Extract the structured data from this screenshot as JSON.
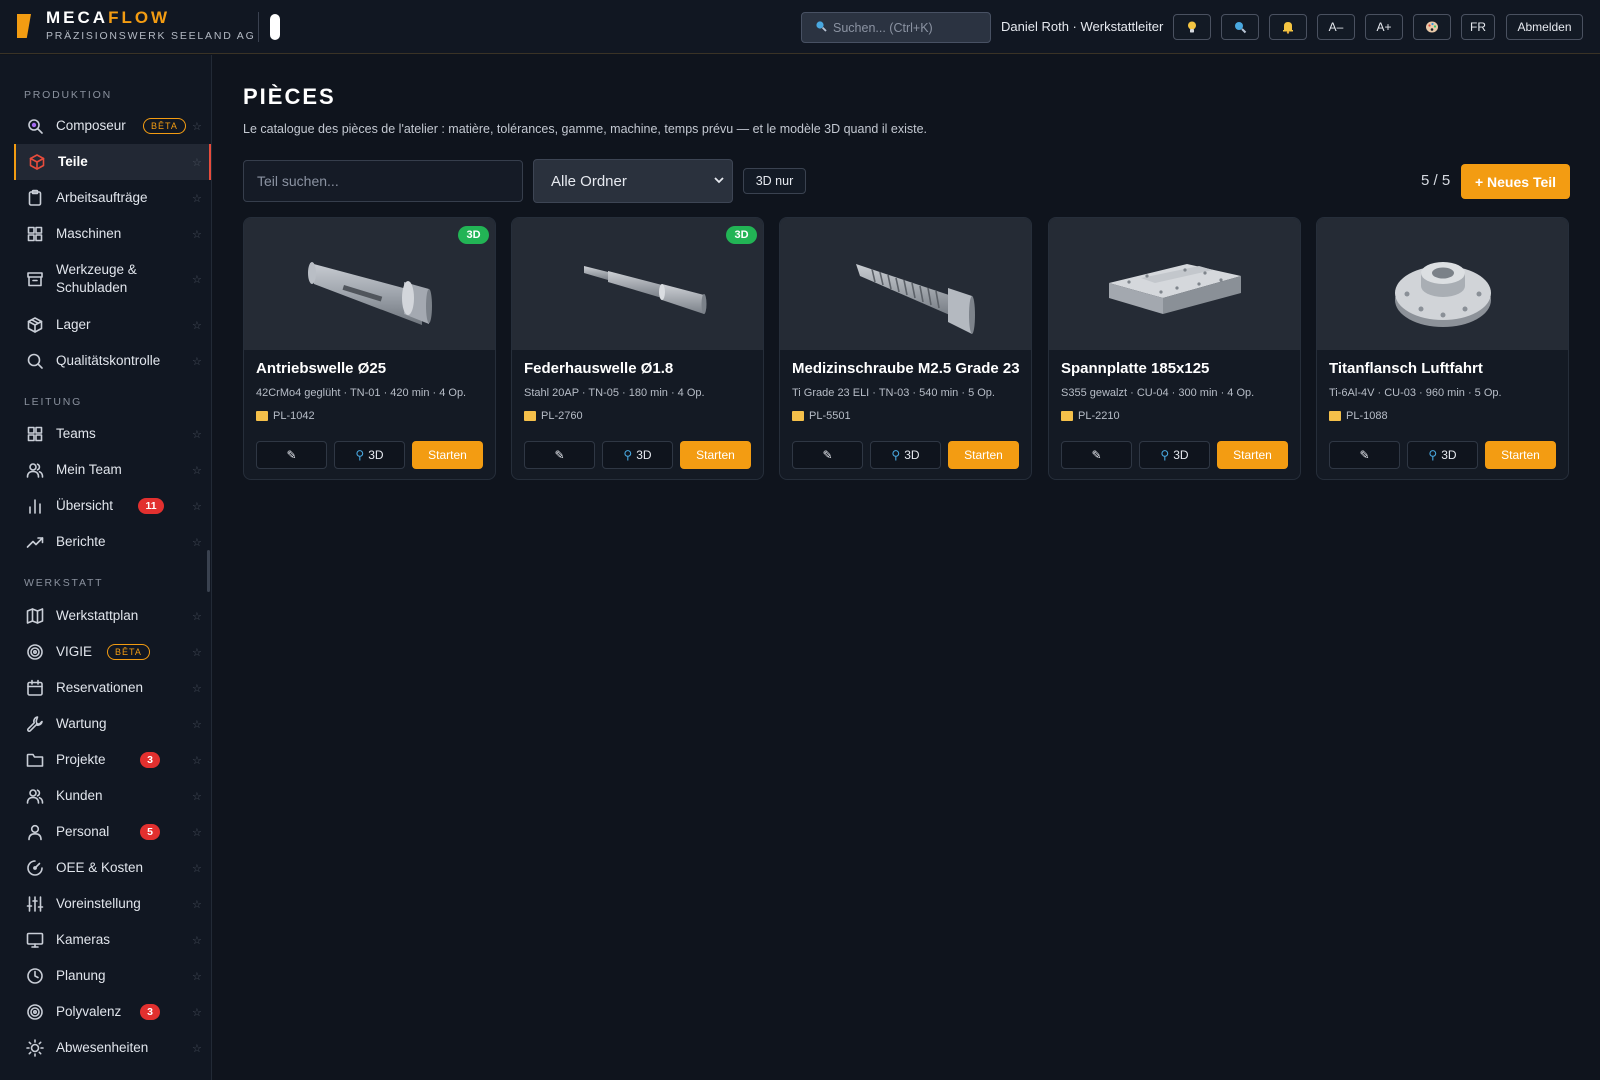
{
  "header": {
    "brand_part1": "MECA",
    "brand_part2": "FLOW",
    "brand_sub": "PRÄZISIONSWERK SEELAND AG",
    "search_placeholder": "Suchen...  (Ctrl+K)",
    "user": "Daniel Roth · Werkstattleiter",
    "font_smaller": "A–",
    "font_larger": "A+",
    "language": "FR",
    "logout": "Abmelden",
    "accent_color": "#f39c12"
  },
  "sidebar": {
    "sections": [
      {
        "title": "PRODUKTION",
        "items": [
          {
            "label": "Composeur",
            "icon": "composer-icon",
            "beta": "BÊTA"
          },
          {
            "label": "Teile",
            "icon": "cube-icon",
            "active": true
          },
          {
            "label": "Arbeitsaufträge",
            "icon": "clipboard-icon"
          },
          {
            "label": "Maschinen",
            "icon": "grid-icon"
          },
          {
            "label": "Werkzeuge & Schubladen",
            "icon": "drawer-icon"
          },
          {
            "label": "Lager",
            "icon": "box-icon"
          },
          {
            "label": "Qualitätskontrolle",
            "icon": "search-icon"
          }
        ]
      },
      {
        "title": "LEITUNG",
        "items": [
          {
            "label": "Teams",
            "icon": "grid-icon"
          },
          {
            "label": "Mein Team",
            "icon": "users-icon"
          },
          {
            "label": "Übersicht",
            "icon": "bar-chart-icon",
            "badge": "11"
          },
          {
            "label": "Berichte",
            "icon": "trend-icon"
          }
        ]
      },
      {
        "title": "WERKSTATT",
        "items": [
          {
            "label": "Werkstattplan",
            "icon": "map-icon"
          },
          {
            "label": "VIGIE",
            "icon": "target-icon",
            "beta": "BÊTA"
          },
          {
            "label": "Reservationen",
            "icon": "calendar-icon"
          },
          {
            "label": "Wartung",
            "icon": "wrench-icon"
          },
          {
            "label": "Projekte",
            "icon": "folder-icon",
            "badge": "3"
          },
          {
            "label": "Kunden",
            "icon": "users-icon"
          },
          {
            "label": "Personal",
            "icon": "user-icon",
            "badge": "5"
          },
          {
            "label": "OEE & Kosten",
            "icon": "gauge-icon"
          },
          {
            "label": "Voreinstellung",
            "icon": "sliders-icon"
          },
          {
            "label": "Kameras",
            "icon": "monitor-icon"
          },
          {
            "label": "Planung",
            "icon": "clock-icon"
          },
          {
            "label": "Polyvalenz",
            "icon": "target-icon",
            "badge": "3"
          },
          {
            "label": "Abwesenheiten",
            "icon": "sun-icon"
          }
        ]
      }
    ]
  },
  "main": {
    "title": "PIÈCES",
    "subtitle": "Le catalogue des pièces de l'atelier : matière, tolérances, gamme, machine, temps prévu — et le modèle 3D quand il existe.",
    "search_placeholder": "Teil suchen...",
    "folder_select": "Alle Ordner",
    "filter_3d": "3D nur",
    "count": "5 / 5",
    "new_button": "+ Neues Teil",
    "edit_icon": "✎",
    "view_label": "3D",
    "start_label": "Starten"
  },
  "parts": [
    {
      "name": "Antriebswelle Ø25",
      "meta": "42CrMo4 geglüht · TN-01 · 420 min · 4 Op.",
      "folder": "PL-1042",
      "badge": "3D",
      "shape": "shaft"
    },
    {
      "name": "Federhauswelle Ø1.8",
      "meta": "Stahl 20AP · TN-05 · 180 min · 4 Op.",
      "folder": "PL-2760",
      "badge": "3D",
      "shape": "thin-shaft"
    },
    {
      "name": "Medizinschraube M2.5 Grade 23",
      "meta": "Ti Grade 23 ELI · TN-03 · 540 min · 5 Op.",
      "folder": "PL-5501",
      "badge": "",
      "shape": "screw"
    },
    {
      "name": "Spannplatte 185x125",
      "meta": "S355 gewalzt · CU-04 · 300 min · 4 Op.",
      "folder": "PL-2210",
      "badge": "",
      "shape": "plate"
    },
    {
      "name": "Titanflansch Luftfahrt",
      "meta": "Ti-6Al-4V · CU-03 · 960 min · 5 Op.",
      "folder": "PL-1088",
      "badge": "",
      "shape": "flange"
    }
  ]
}
